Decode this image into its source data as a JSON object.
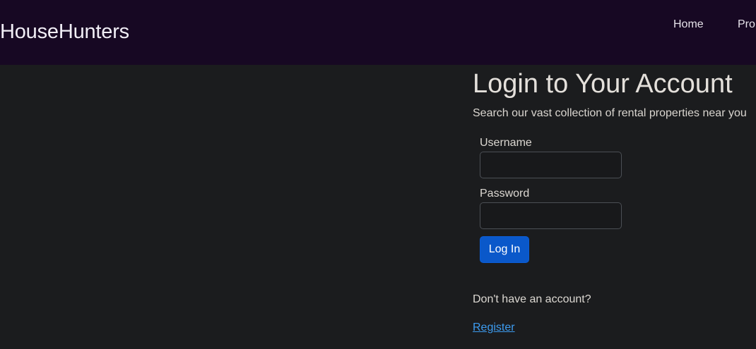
{
  "header": {
    "brand": "HouseHunters",
    "nav": [
      {
        "label": "Home"
      },
      {
        "label": "Pro"
      }
    ]
  },
  "login": {
    "title": "Login to Your Account",
    "subtitle": "Search our vast collection of rental properties near you",
    "username_label": "Username",
    "username_value": "",
    "password_label": "Password",
    "password_value": "",
    "submit_label": "Log In",
    "no_account_text": "Don't have an account?",
    "register_label": "Register"
  },
  "colors": {
    "page_background": "#1b1c1e",
    "navbar_background": "#170823",
    "primary_button": "#0a58ca",
    "link": "#3d9cf0"
  }
}
